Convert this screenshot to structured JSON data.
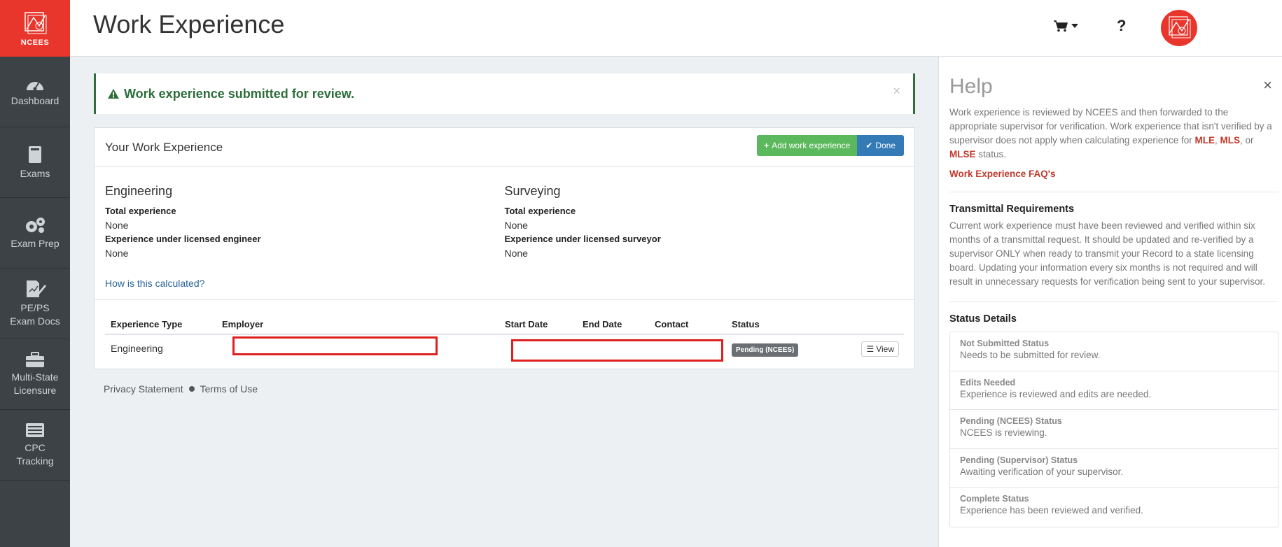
{
  "logo": {
    "text": "NCEES"
  },
  "sidebar": {
    "items": [
      {
        "label": "Dashboard"
      },
      {
        "label": "Exams"
      },
      {
        "label": "Exam Prep"
      },
      {
        "line1": "PE/PS",
        "line2": "Exam Docs"
      },
      {
        "line1": "Multi-State",
        "line2": "Licensure"
      },
      {
        "line1": "CPC",
        "line2": "Tracking"
      }
    ]
  },
  "header": {
    "title": "Work Experience",
    "help_label": "?"
  },
  "alert": {
    "message": "Work experience submitted for review.",
    "close": "×"
  },
  "panel": {
    "title": "Your Work Experience",
    "add_button": "Add work experience",
    "done_button": "Done",
    "engineering": {
      "heading": "Engineering",
      "total_label": "Total experience",
      "total_value": "None",
      "licensed_label": "Experience under licensed engineer",
      "licensed_value": "None"
    },
    "surveying": {
      "heading": "Surveying",
      "total_label": "Total experience",
      "total_value": "None",
      "licensed_label": "Experience under licensed surveyor",
      "licensed_value": "None"
    },
    "calc_link": "How is this calculated?"
  },
  "table": {
    "headers": [
      "Experience Type",
      "Employer",
      "Start Date",
      "End Date",
      "Contact",
      "Status"
    ],
    "rows": [
      {
        "type": "Engineering",
        "status": "Pending (NCEES)",
        "view": "View"
      }
    ]
  },
  "footer": {
    "privacy": "Privacy Statement",
    "terms": "Terms of Use"
  },
  "help": {
    "title": "Help",
    "close": "×",
    "intro_1": "Work experience is reviewed by NCEES and then forwarded to the appropriate supervisor for verification. Work experience that isn't verified by a supervisor does not apply when calculating experience for ",
    "mle": "MLE",
    "comma": ", ",
    "mls": "MLS",
    "or": ", or",
    "mlse": "MLSE",
    "intro_2": " status.",
    "faq_link": "Work Experience FAQ's",
    "transmittal_heading": "Transmittal Requirements",
    "transmittal_text": "Current work experience must have been reviewed and verified within six months of a transmittal request. It should be updated and re-verified by a supervisor ONLY when ready to transmit your Record to a state licensing board. Updating your information every six months is not required and will result in unnecessary requests for verification being sent to your supervisor.",
    "status_heading": "Status Details",
    "statuses": [
      {
        "name": "Not Submitted Status",
        "desc": "Needs to be submitted for review."
      },
      {
        "name": "Edits Needed",
        "desc": "Experience is reviewed and edits are needed."
      },
      {
        "name": "Pending (NCEES) Status",
        "desc": "NCEES is reviewing."
      },
      {
        "name": "Pending (Supervisor) Status",
        "desc": "Awaiting verification of your supervisor."
      },
      {
        "name": "Complete Status",
        "desc": "Experience has been reviewed and verified."
      }
    ]
  },
  "colors": {
    "brand_red": "#e8362c",
    "sidebar_bg": "#3d4247",
    "success_green": "#5cb85c",
    "primary_blue": "#337ab7",
    "alert_green": "#2d6e3a",
    "redaction_red": "#e02020"
  }
}
